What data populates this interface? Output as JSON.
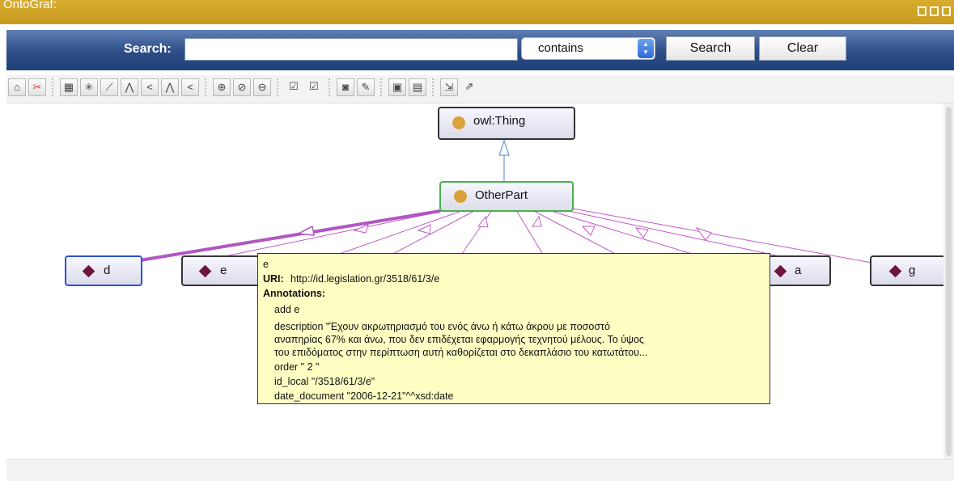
{
  "window": {
    "title": "OntoGraf:"
  },
  "search": {
    "label": "Search:",
    "value": "",
    "mode": "contains",
    "search_button": "Search",
    "clear_button": "Clear"
  },
  "graph": {
    "root": {
      "label": "owl:Thing"
    },
    "parent": {
      "label": "OtherPart"
    },
    "children": [
      "d",
      "e",
      "a",
      "g"
    ]
  },
  "tooltip": {
    "name": "e",
    "uri_label": "URI:",
    "uri": "http://id.legislation.gr/3518/61/3/e",
    "annotations_label": "Annotations:",
    "add": "add e",
    "description_1": "description \"Έχουν ακρωτηριασμό του ενός άνω ή κάτω άκρου με ποσοστό",
    "description_2": "αναπηρίας 67% και άνω, που δεν επιδέχεται εφαρμογής τεχνητού μέλους. Το ύψος",
    "description_3": "του επιδόματος στην περίπτωση αυτή καθορίζεται στο δεκαπλάσιο του κατωτάτου...",
    "order": "order \" 2 \"",
    "id_local": "id_local \"/3518/61/3/e\"",
    "date_document": "date_document \"2006-12-21\"^^xsd:date"
  },
  "colors": {
    "titlebar": "#c9a02a",
    "searchbar": "#2c4d86",
    "class_dot": "#d9a23a",
    "individual_diamond": "#6b1540",
    "edge_subclass": "#6a9ad0",
    "edge_individual": "#c05ac8",
    "selected_border": "#2d50d8",
    "parent_border": "#4caf50",
    "tooltip_bg": "#ffffc4"
  }
}
